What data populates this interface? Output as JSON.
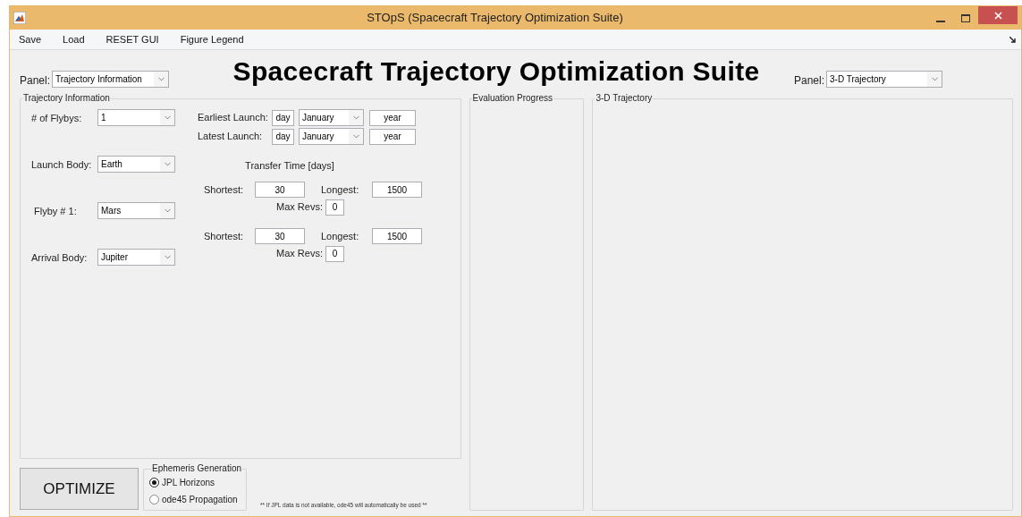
{
  "window": {
    "title": "STOpS (Spacecraft Trajectory Optimization Suite)"
  },
  "menu": [
    "Save",
    "Load",
    "RESET GUI",
    "Figure Legend"
  ],
  "heading": "Spacecraft Trajectory Optimization Suite",
  "left_panel_selector": {
    "label": "Panel:",
    "value": "Trajectory Information"
  },
  "right_panel_selector": {
    "label": "Panel:",
    "value": "3-D Trajectory"
  },
  "trajectory_panel": {
    "title": "Trajectory Information",
    "fields": [
      {
        "label": "# of Flybys:",
        "value": "1"
      },
      {
        "label": "Launch Body:",
        "value": "Earth"
      },
      {
        "label": "Flyby # 1:",
        "value": "Mars"
      },
      {
        "label": "Arrival Body:",
        "value": "Jupiter"
      }
    ],
    "launch_windows": [
      {
        "label": "Earliest Launch:",
        "day": "day",
        "month": "January",
        "year": "year"
      },
      {
        "label": "Latest Launch:",
        "day": "day",
        "month": "January",
        "year": "year"
      }
    ],
    "transfer_time": {
      "title": "Transfer Time [days]",
      "legs": [
        {
          "shortest_label": "Shortest:",
          "shortest": "30",
          "longest_label": "Longest:",
          "longest": "1500",
          "max_revs_label": "Max Revs:",
          "max_revs": "0"
        },
        {
          "shortest_label": "Shortest:",
          "shortest": "30",
          "longest_label": "Longest:",
          "longest": "1500",
          "max_revs_label": "Max Revs:",
          "max_revs": "0"
        }
      ]
    }
  },
  "evaluation_panel": {
    "title": "Evaluation Progress"
  },
  "trajectory_3d_panel": {
    "title": "3-D Trajectory"
  },
  "optimize_button": "OPTIMIZE",
  "ephemeris": {
    "title": "Ephemeris Generation",
    "options": [
      {
        "label": "JPL Horizons",
        "selected": true
      },
      {
        "label": "ode45 Propagation",
        "selected": false
      }
    ]
  },
  "note": "** If JPL data is not available, ode45 will automatically be used **"
}
